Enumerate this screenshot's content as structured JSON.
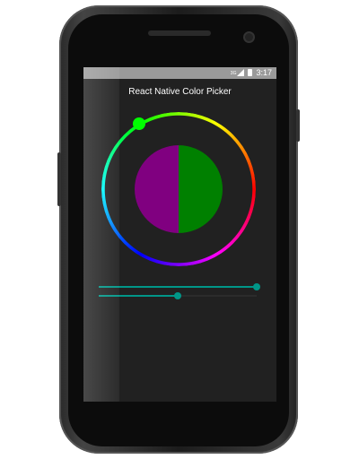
{
  "status_bar": {
    "network": "3G",
    "time": "3:17",
    "icons": [
      "signal-icon",
      "battery-icon"
    ]
  },
  "app": {
    "title": "React Native Color Picker"
  },
  "color_picker": {
    "selected_hue_color": "#00ff00",
    "old_color": "#800080",
    "new_color": "#008000"
  },
  "sliders": [
    {
      "value": 1.0,
      "color": "#009688"
    },
    {
      "value": 0.5,
      "color": "#009688"
    }
  ]
}
